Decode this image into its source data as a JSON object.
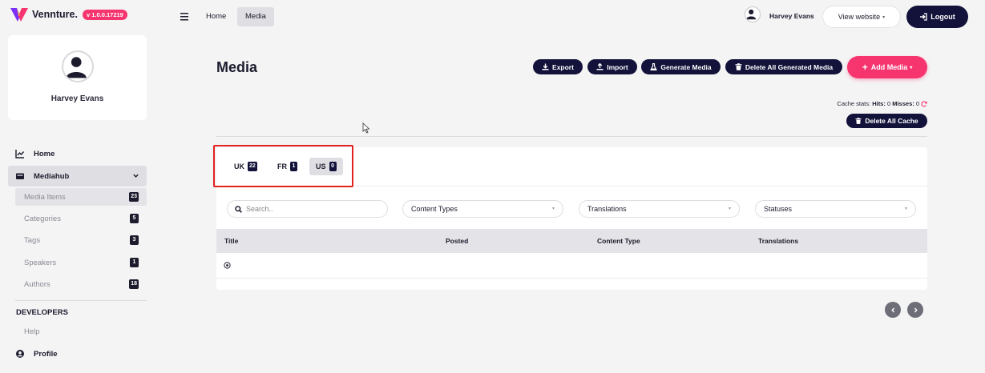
{
  "brand": {
    "name": "Vennture.",
    "version": "v 1.0.0.17219"
  },
  "profile": {
    "name": "Harvey Evans"
  },
  "sidebar": {
    "home": "Home",
    "mediahub": "Mediahub",
    "sub_items": [
      {
        "label": "Media Items",
        "count": "23"
      },
      {
        "label": "Categories",
        "count": "5"
      },
      {
        "label": "Tags",
        "count": "3"
      },
      {
        "label": "Speakers",
        "count": "1"
      },
      {
        "label": "Authors",
        "count": "18"
      }
    ],
    "developers_title": "DEVELOPERS",
    "help": "Help",
    "profile": "Profile"
  },
  "topbar": {
    "breadcrumb_home": "Home",
    "breadcrumb_media": "Media",
    "user_name": "Harvey Evans",
    "view_website": "View website",
    "logout": "Logout"
  },
  "main": {
    "title": "Media",
    "buttons": {
      "export": "Export",
      "import": "Import",
      "generate": "Generate Media",
      "delete_generated": "Delete All Generated Media",
      "add_media": "Add Media",
      "delete_cache": "Delete All Cache"
    },
    "cache_stats": {
      "prefix": "Cache stats:",
      "hits_label": "Hits:",
      "hits": "0",
      "misses_label": "Misses:",
      "misses": "0"
    },
    "region_tabs": [
      {
        "label": "UK",
        "count": "22"
      },
      {
        "label": "FR",
        "count": "1"
      },
      {
        "label": "US",
        "count": "0"
      }
    ],
    "search": {
      "placeholder": "Search..",
      "value": ""
    },
    "filters": {
      "content_types": "Content Types",
      "translations": "Translations",
      "statuses": "Statuses"
    },
    "table": {
      "columns": [
        "Title",
        "Posted",
        "Content Type",
        "Translations"
      ]
    }
  },
  "colors": {
    "accent": "#f6356f",
    "navy": "#12123a",
    "highlight_border": "#e2221e"
  }
}
